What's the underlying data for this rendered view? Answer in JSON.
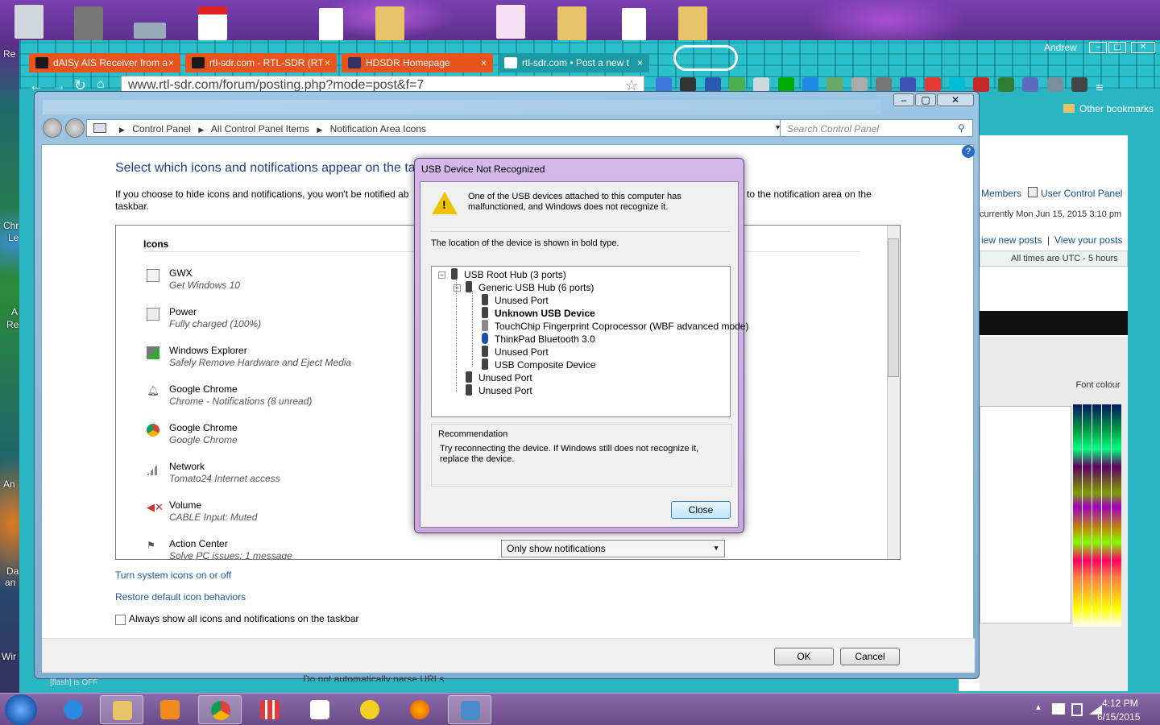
{
  "desktop": {
    "side_labels": [
      "Re",
      "Chr",
      "Le",
      "A",
      "Re",
      "An",
      "Da",
      "an",
      "Wir"
    ]
  },
  "chrome": {
    "profile_name": "Andrew",
    "tabs": [
      {
        "label": "dAISy AIS Receiver from a"
      },
      {
        "label": "rtl-sdr.com - RTL-SDR (RT"
      },
      {
        "label": "HDSDR Homepage"
      },
      {
        "label": "rtl-sdr.com • Post a new t"
      }
    ],
    "url": "www.rtl-sdr.com/forum/posting.php?mode=post&f=7",
    "other_bookmarks": "Other bookmarks",
    "colors": {
      "frame": "#29b6c2",
      "tab": "#e8531e"
    }
  },
  "forum": {
    "members": "Members",
    "user_cp": "User Control Panel",
    "currently": "currently Mon Jun 15, 2015 3:10 pm",
    "new_posts": "iew new posts",
    "sep": "|",
    "your_posts": "View your posts",
    "timezone": "All times are UTC - 5 hours",
    "font_colour": "Font colour",
    "flash": "[flash] is OFF",
    "below": "Do not automatically parse URLs"
  },
  "control_panel": {
    "breadcrumb": [
      "Control Panel",
      "All Control Panel Items",
      "Notification Area Icons"
    ],
    "search_placeholder": "Search Control Panel",
    "title": "Select which icons and notifications appear on the tas",
    "desc_left": "If you choose to hide icons and notifications, you won't be notified ab",
    "desc_right": "to the notification area on the",
    "desc_line2": "taskbar.",
    "icons_header": "Icons",
    "icons": [
      {
        "name": "GWX",
        "sub": "Get Windows 10"
      },
      {
        "name": "Power",
        "sub": "Fully charged (100%)"
      },
      {
        "name": "Windows Explorer",
        "sub": "Safely Remove Hardware and Eject Media"
      },
      {
        "name": "Google Chrome",
        "sub": "Chrome - Notifications (8 unread)"
      },
      {
        "name": "Google Chrome",
        "sub": "Google Chrome"
      },
      {
        "name": "Network",
        "sub": "Tomato24 Internet access"
      },
      {
        "name": "Volume",
        "sub": "CABLE Input: Muted"
      },
      {
        "name": "Action Center",
        "sub": "Solve PC issues: 1 message"
      }
    ],
    "behavior_value": "Only show notifications",
    "link_system_icons": "Turn system icons on or off",
    "link_restore": "Restore default icon behaviors",
    "always_show": "Always show all icons and notifications on the taskbar",
    "ok": "OK",
    "cancel": "Cancel"
  },
  "usb_dialog": {
    "title": "USB Device Not Recognized",
    "message": "One of the USB devices attached to this computer has malfunctioned, and Windows does not recognize it.",
    "location_note": "The location of the device is shown in bold type.",
    "tree": [
      {
        "label": "USB Root Hub (3 ports)",
        "bold": false
      },
      {
        "label": "Generic USB Hub (6 ports)",
        "bold": false
      },
      {
        "label": "Unused Port",
        "bold": false
      },
      {
        "label": "Unknown USB Device",
        "bold": true
      },
      {
        "label": "TouchChip Fingerprint Coprocessor (WBF advanced mode)",
        "bold": false
      },
      {
        "label": "ThinkPad Bluetooth 3.0",
        "bold": false
      },
      {
        "label": "Unused Port",
        "bold": false
      },
      {
        "label": "USB Composite Device",
        "bold": false
      },
      {
        "label": "Unused Port",
        "bold": false
      },
      {
        "label": "Unused Port",
        "bold": false
      }
    ],
    "recommendation_header": "Recommendation",
    "recommendation": "Try reconnecting the device. If Windows still does not recognize it, replace the device.",
    "close": "Close"
  },
  "taskbar": {
    "time": "4:12 PM",
    "date": "6/15/2015"
  }
}
